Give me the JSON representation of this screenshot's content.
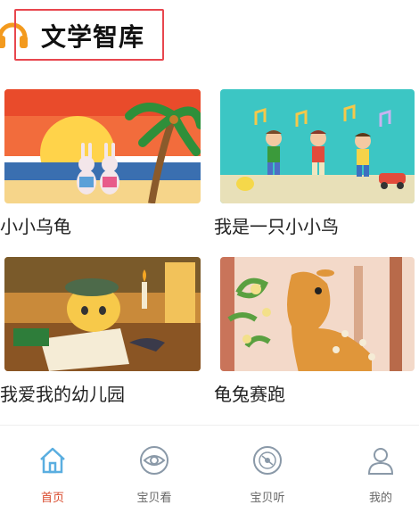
{
  "header": {
    "title": "文学智库",
    "icon": "headphones-icon"
  },
  "cards": [
    {
      "title": "小小乌龟",
      "art": "two-rabbits-sunset-beach"
    },
    {
      "title": "我是一只小小鸟",
      "art": "children-music-notes"
    },
    {
      "title": "我爱我的幼儿园",
      "art": "puppy-reading-book"
    },
    {
      "title": "龟兔赛跑",
      "art": "deer-in-forest"
    }
  ],
  "tabs": [
    {
      "label": "首页",
      "icon": "home-icon",
      "active": true
    },
    {
      "label": "宝贝看",
      "icon": "eye-icon",
      "active": false
    },
    {
      "label": "宝贝听",
      "icon": "disc-icon",
      "active": false
    },
    {
      "label": "我的",
      "icon": "user-icon",
      "active": false
    }
  ],
  "colors": {
    "accent": "#d94a2c",
    "title_box": "#e8464e",
    "headphones": "#f39a1e"
  }
}
